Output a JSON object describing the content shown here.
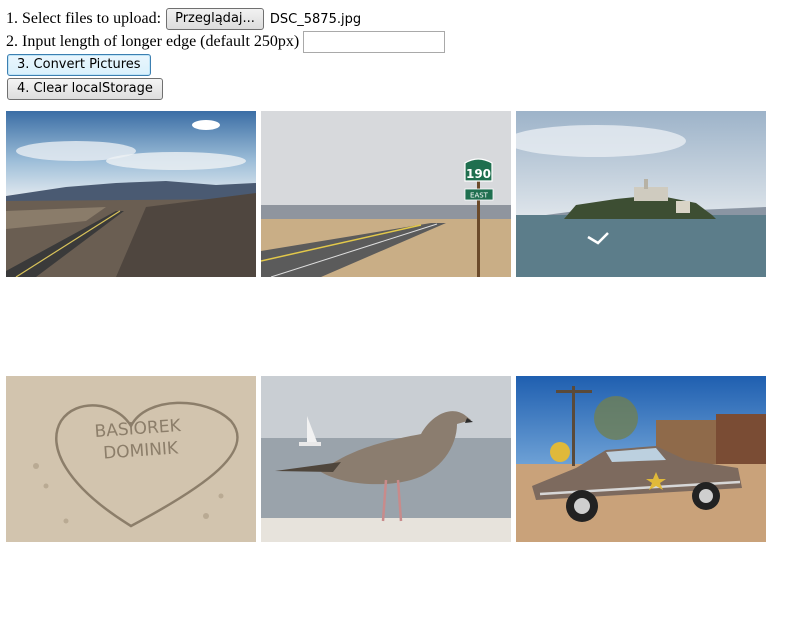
{
  "upload": {
    "step1_label": "1. Select files to upload:",
    "browse_label": "Przeglądaj...",
    "selected_file": "DSC_5875.jpg"
  },
  "edge": {
    "step2_label": "2. Input length of longer edge (default 250px)",
    "value": "",
    "placeholder": ""
  },
  "actions": {
    "convert_label": "3. Convert Pictures",
    "clear_label": "4. Clear localStorage"
  },
  "route_sign": {
    "number": "190",
    "direction": "EAST"
  },
  "sand_writing": {
    "line1": "BASIOREK",
    "line2": "DOMINIK"
  },
  "thumbnails": [
    {
      "subject": "desert-road-photo"
    },
    {
      "subject": "highway-190-sign-photo"
    },
    {
      "subject": "alcatraz-island-photo"
    },
    {
      "subject": "sand-heart-writing-photo"
    },
    {
      "subject": "seagull-photo"
    },
    {
      "subject": "rusty-sheriff-car-photo"
    }
  ],
  "colors": {
    "button_focus_border": "#3c7fb1",
    "sign_green": "#1f6f4f"
  }
}
